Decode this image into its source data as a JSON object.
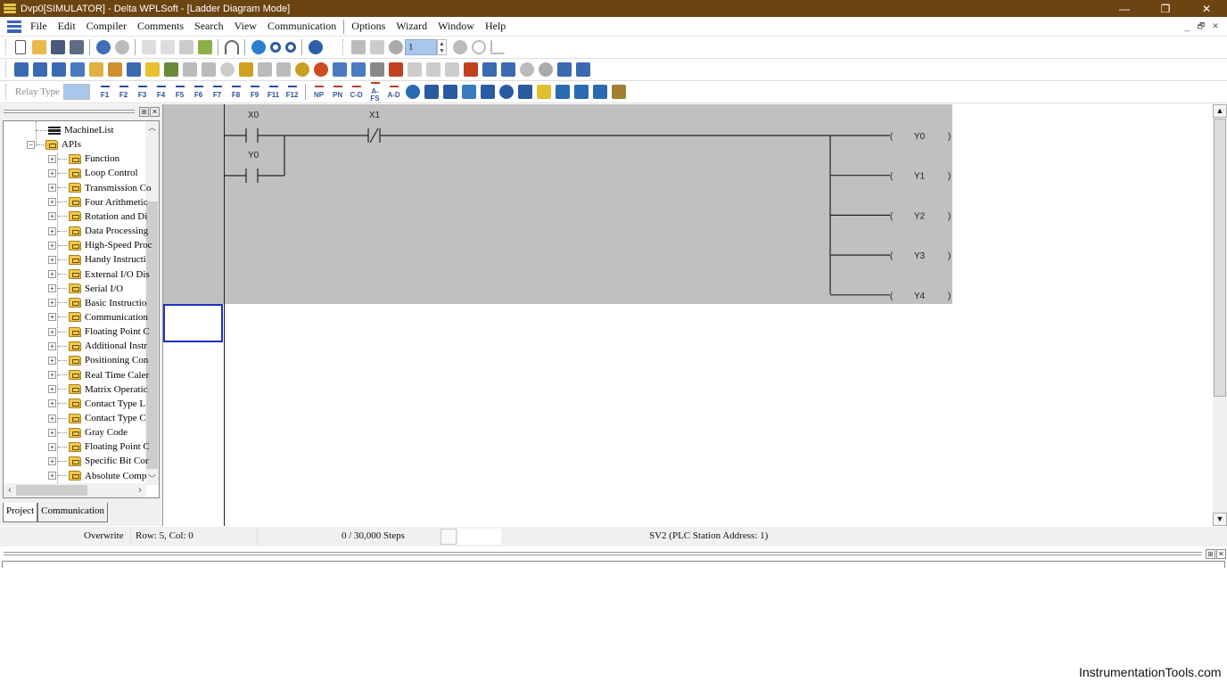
{
  "window": {
    "title": "Dvp0[SIMULATOR] - Delta WPLSoft - [Ladder Diagram Mode]",
    "controls": {
      "minimize": "—",
      "maximize": "❐",
      "close": "✕"
    }
  },
  "menu": {
    "items": [
      "File",
      "Edit",
      "Compiler",
      "Comments",
      "Search",
      "View",
      "Communication",
      "Options",
      "Wizard",
      "Window",
      "Help"
    ],
    "mdi_controls": {
      "minimize": "_",
      "restore": "🗗",
      "close": "✕"
    }
  },
  "toolbar1": {
    "buttons": [
      "new-icon",
      "open-icon",
      "save-icon",
      "save-as-icon",
      "online-icon",
      "offline-icon",
      "cut-icon",
      "copy-icon",
      "paste-icon",
      "eraser-icon",
      "jump-icon",
      "zoom-fit-icon",
      "zoom-in-icon",
      "zoom-out-icon",
      "help-icon",
      "run-icon",
      "stop-icon",
      "monitor-icon"
    ],
    "station_spinner_value": "1",
    "trailing": [
      "stop-circle-icon",
      "refresh-icon",
      "link-icon"
    ]
  },
  "toolbar2": {
    "buttons": [
      "ladder-mode-icon",
      "instruction-mode-icon",
      "sfc-mode-icon",
      "device-comment-icon",
      "edit-comment-icon",
      "io-map-icon",
      "table-icon",
      "folder-icon",
      "pen-icon",
      "device-monitor-icon",
      "memory-icon",
      "bulb-icon",
      "plc-mode-icon",
      "register-icon",
      "device-table-icon",
      "globe-icon",
      "stop-sign-icon",
      "pc-to-plc-icon",
      "plc-to-pc-icon",
      "satellite-icon",
      "code-icon",
      "chn-icon",
      "bit-icon",
      "bit2-icon",
      "transfer-icon",
      "edit-icon",
      "window-icon",
      "zoom-icon",
      "find-icon",
      "network-icon",
      "cloud-icon"
    ]
  },
  "toolbar3": {
    "relay_type_label": "Relay Type",
    "fkeys": [
      "F1",
      "F2",
      "F3",
      "F4",
      "F5",
      "F6",
      "F7",
      "F8",
      "F9",
      "F11",
      "F12"
    ],
    "extras": [
      "NP",
      "PN",
      "C-D",
      "A-FS",
      "A-D"
    ],
    "icons": [
      "timer-icon",
      "pid-icon",
      "network-icon",
      "wave-icon",
      "compare-icon",
      "position-icon",
      "grid-icon",
      "mail-icon",
      "axis-icon",
      "column-icon",
      "split-icon",
      "counter-icon"
    ]
  },
  "project_pane": {
    "tree": [
      {
        "label": "MachineList",
        "level": 1,
        "icon": "machine-list-icon"
      },
      {
        "label": "APIs",
        "level": 1,
        "icon": "api-folder-icon",
        "expanded": true
      },
      {
        "label": "Function",
        "level": 2
      },
      {
        "label": "Loop Control",
        "level": 2
      },
      {
        "label": "Transmission Co",
        "level": 2
      },
      {
        "label": "Four Arithmetic",
        "level": 2
      },
      {
        "label": "Rotation and Di",
        "level": 2
      },
      {
        "label": "Data Processing",
        "level": 2
      },
      {
        "label": "High-Speed Proc",
        "level": 2
      },
      {
        "label": "Handy Instructi",
        "level": 2
      },
      {
        "label": "External I/O Dis",
        "level": 2
      },
      {
        "label": "Serial I/O",
        "level": 2
      },
      {
        "label": "Basic Instructio",
        "level": 2
      },
      {
        "label": "Communication",
        "level": 2
      },
      {
        "label": "Floating Point C",
        "level": 2
      },
      {
        "label": "Additional Instr",
        "level": 2
      },
      {
        "label": "Positioning Con",
        "level": 2
      },
      {
        "label": "Real Time Caler",
        "level": 2
      },
      {
        "label": "Matrix Operatic",
        "level": 2
      },
      {
        "label": "Contact Type L",
        "level": 2
      },
      {
        "label": "Contact Type C",
        "level": 2
      },
      {
        "label": "Gray Code",
        "level": 2
      },
      {
        "label": "Floating Point C",
        "level": 2
      },
      {
        "label": "Specific Bit Cor",
        "level": 2
      },
      {
        "label": "Absolute Comp",
        "level": 2
      }
    ],
    "tabs": [
      "Project",
      "Communication"
    ]
  },
  "ladder": {
    "contacts": [
      {
        "device": "X0",
        "type": "normally-open"
      },
      {
        "device": "Y0",
        "type": "normally-open",
        "parallel": true
      },
      {
        "device": "X1",
        "type": "normally-closed"
      }
    ],
    "coils": [
      "Y0",
      "Y1",
      "Y2",
      "Y3",
      "Y4"
    ]
  },
  "status_bar": {
    "mode": "Overwrite",
    "position": "Row: 5, Col: 0",
    "steps": "0 / 30,000 Steps",
    "plc": "SV2 (PLC Station Address: 1)"
  },
  "watermark": "InstrumentationTools.com"
}
